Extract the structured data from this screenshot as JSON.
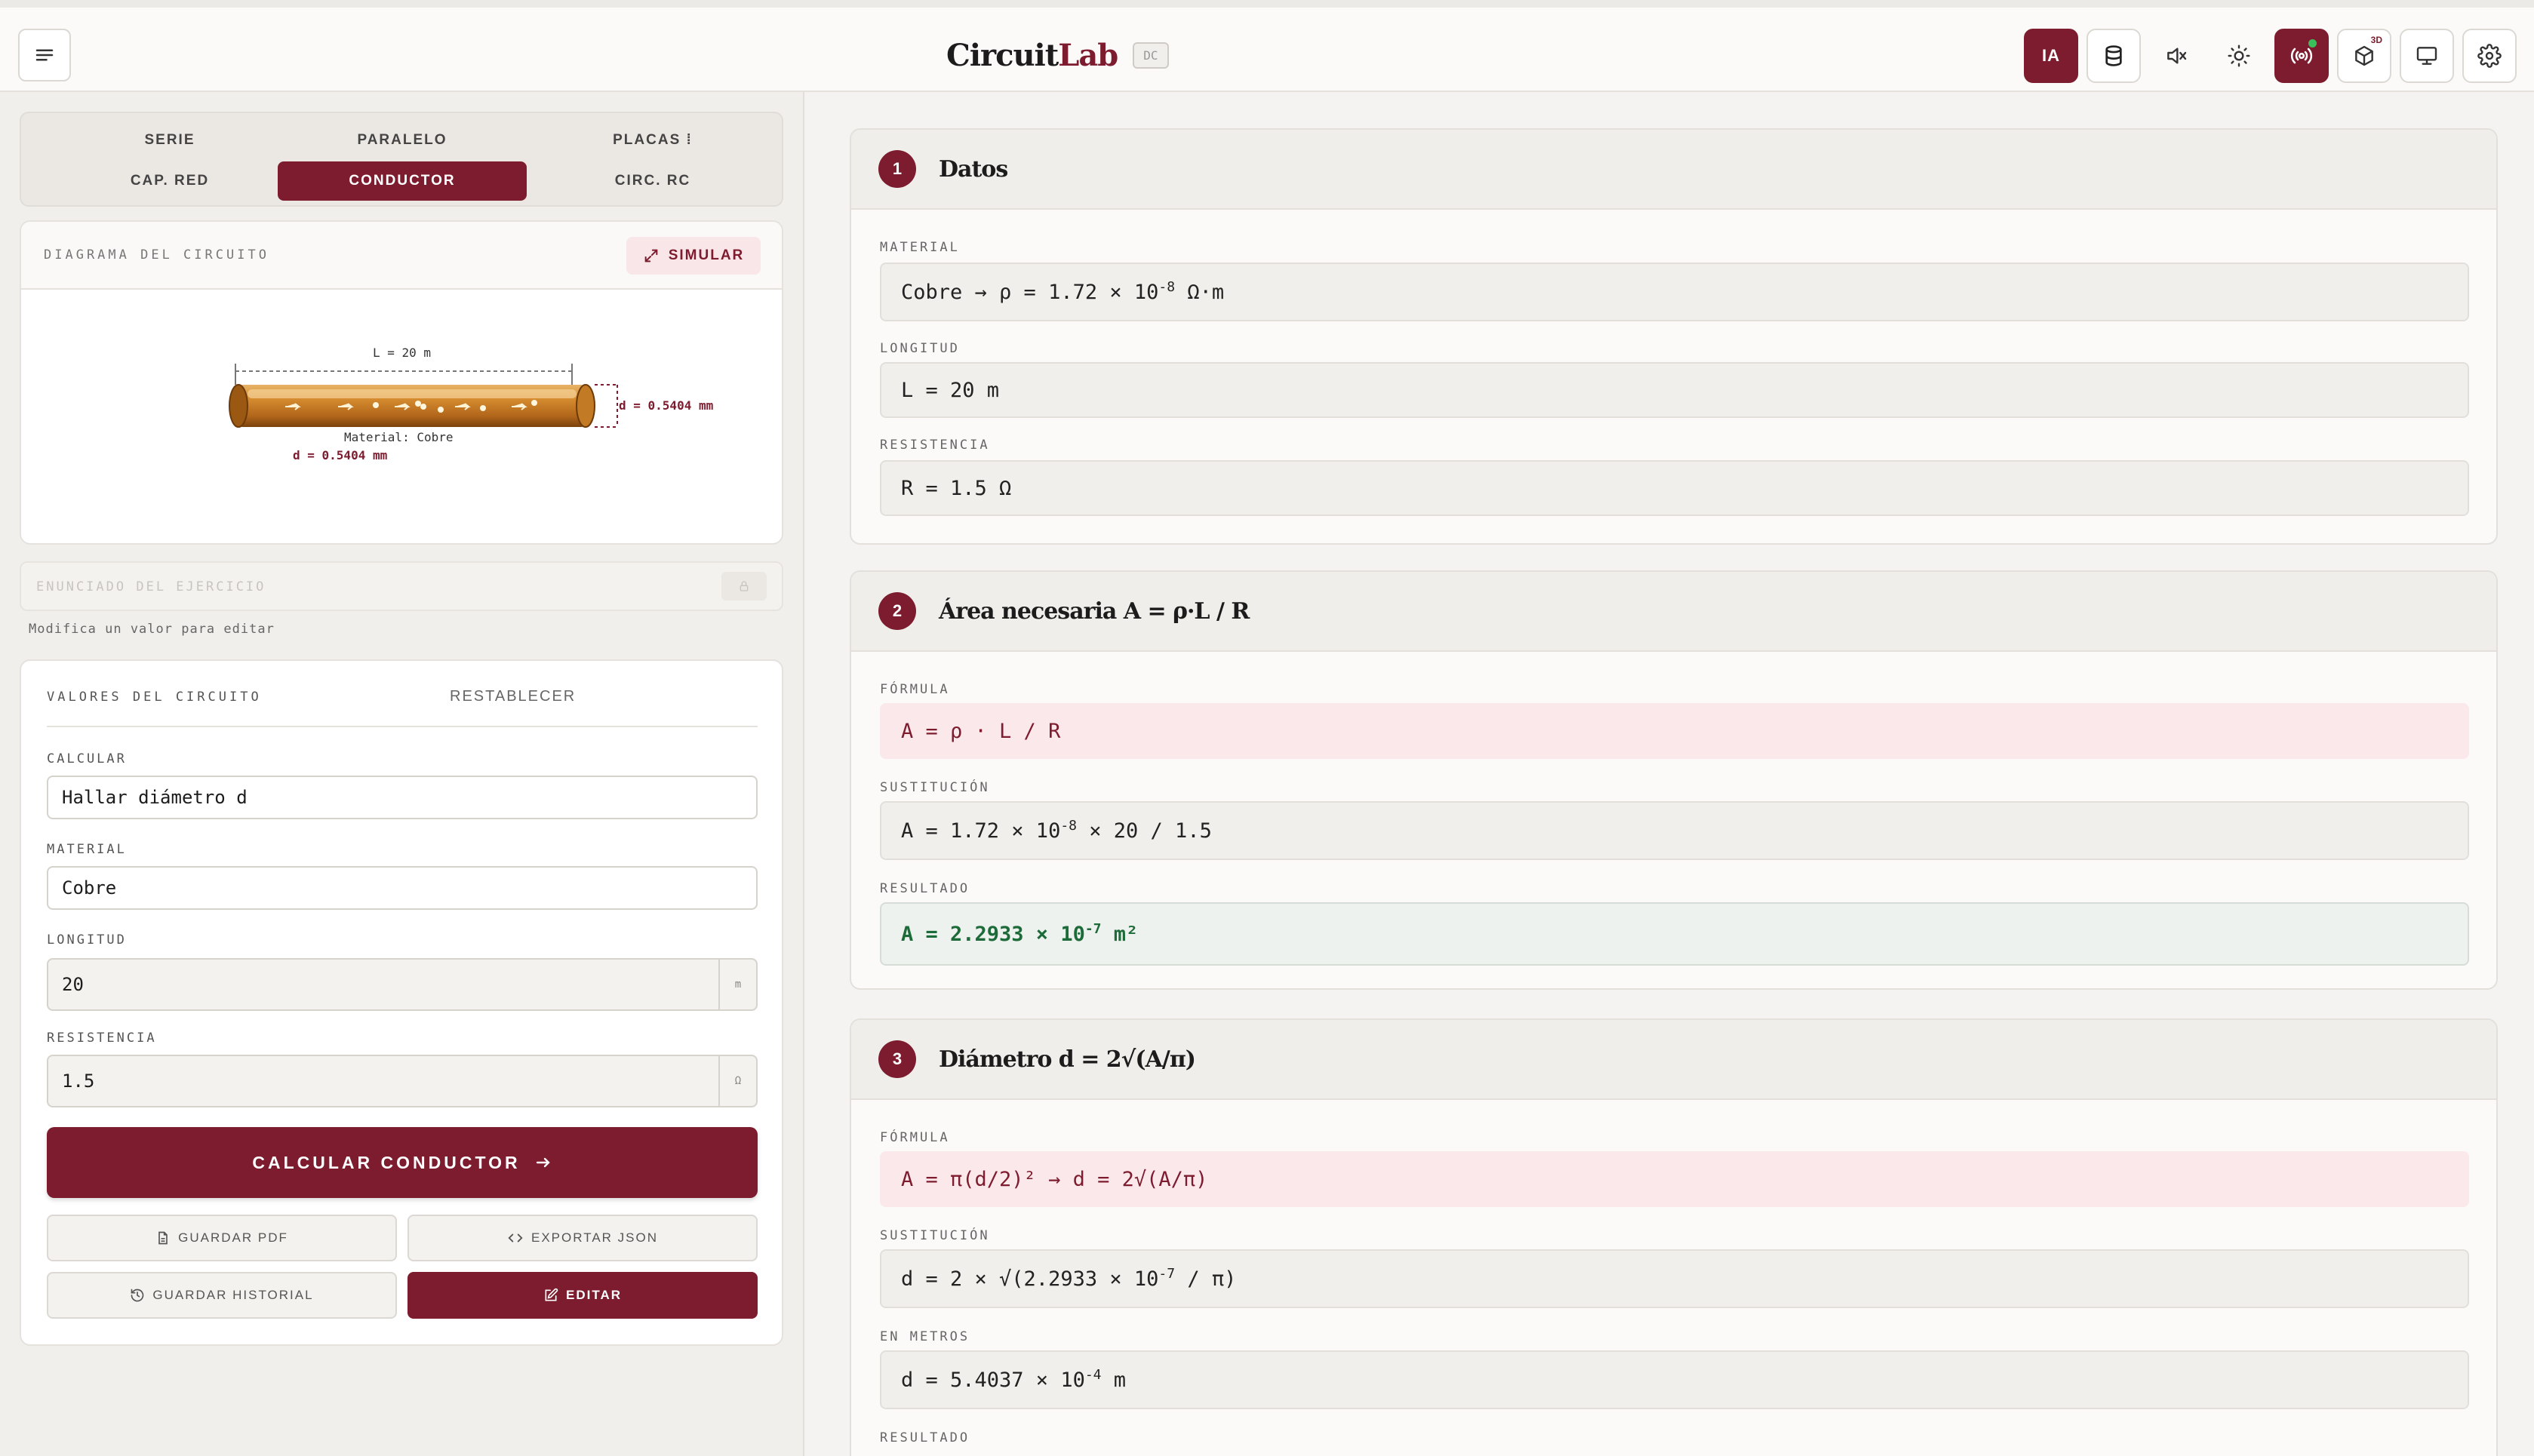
{
  "header": {
    "brand_bold": "Circuit",
    "brand_accent": "Lab",
    "badge": "DC",
    "ai_label": "IA",
    "badge_3d": "3D"
  },
  "left": {
    "tabs": [
      "SERIE",
      "PARALELO",
      "PLACAS ⁞",
      "CAP. RED",
      "CONDUCTOR",
      "CIRC. RC"
    ],
    "diagram": {
      "title": "DIAGRAMA DEL CIRCUITO",
      "simulate": "SIMULAR",
      "length_label": "L = 20 m",
      "diameter_label": "d = 0.5404 mm",
      "material_label": "Material: Cobre",
      "diameter_label2": "d = 0.5404 mm"
    },
    "statement_placeholder": "ENUNCIADO DEL EJERCICIO",
    "hint": "Modifica un valor para editar",
    "values": {
      "title": "VALORES DEL CIRCUITO",
      "reset": "RESTABLECER",
      "calc_label": "CALCULAR",
      "calc_value": "Hallar diámetro d",
      "material_label": "MATERIAL",
      "material_value": "Cobre",
      "length_label": "LONGITUD",
      "length_value": "20",
      "length_unit": "m",
      "res_label": "RESISTENCIA",
      "res_value": "1.5",
      "res_unit": "Ω",
      "calc_button": "CALCULAR CONDUCTOR",
      "pdf": "GUARDAR PDF",
      "json": "EXPORTAR JSON",
      "history": "GUARDAR HISTORIAL",
      "edit": "EDITAR"
    }
  },
  "steps": {
    "s1": {
      "num": "1",
      "title": "Datos",
      "material_label": "MATERIAL",
      "material_a": "Cobre → ρ = 1.72 × 10",
      "material_exp": "-8",
      "material_b": " Ω·m",
      "length_label": "LONGITUD",
      "length": "L = 20 m",
      "res_label": "RESISTENCIA",
      "res": "R = 1.5 Ω"
    },
    "s2": {
      "num": "2",
      "title": "Área necesaria A = ρ·L / R",
      "formula_label": "FÓRMULA",
      "formula": "A = ρ · L / R",
      "subst_label": "SUSTITUCIÓN",
      "subst_a": "A = 1.72 × 10",
      "subst_exp": "-8",
      "subst_b": " × 20 / 1.5",
      "result_label": "RESULTADO",
      "result_a": "A = 2.2933 × 10",
      "result_exp": "-7",
      "result_b": " m²"
    },
    "s3": {
      "num": "3",
      "title": "Diámetro d = 2√(A/π)",
      "formula_label": "FÓRMULA",
      "formula": "A = π(d/2)² → d = 2√(A/π)",
      "subst_label": "SUSTITUCIÓN",
      "subst_a": "d = 2 × √(2.2933 × 10",
      "subst_exp": "-7",
      "subst_b": " / π)",
      "meters_label": "EN METROS",
      "meters_a": "d = 5.4037 × 10",
      "meters_exp": "-4",
      "meters_b": " m",
      "result_label": "RESULTADO"
    }
  },
  "colors": {
    "accent": "#7d1c2e",
    "success": "#1e6b3a",
    "status_dot": "#3bbf5a"
  },
  "icons": [
    "menu-icon",
    "ai-icon",
    "database-icon",
    "mute-icon",
    "sun-icon",
    "broadcast-icon",
    "cube-3d-icon",
    "monitor-icon",
    "gear-icon",
    "expand-icon",
    "lock-icon",
    "file-icon",
    "code-icon",
    "history-icon",
    "edit-icon",
    "arrow-right-icon"
  ]
}
